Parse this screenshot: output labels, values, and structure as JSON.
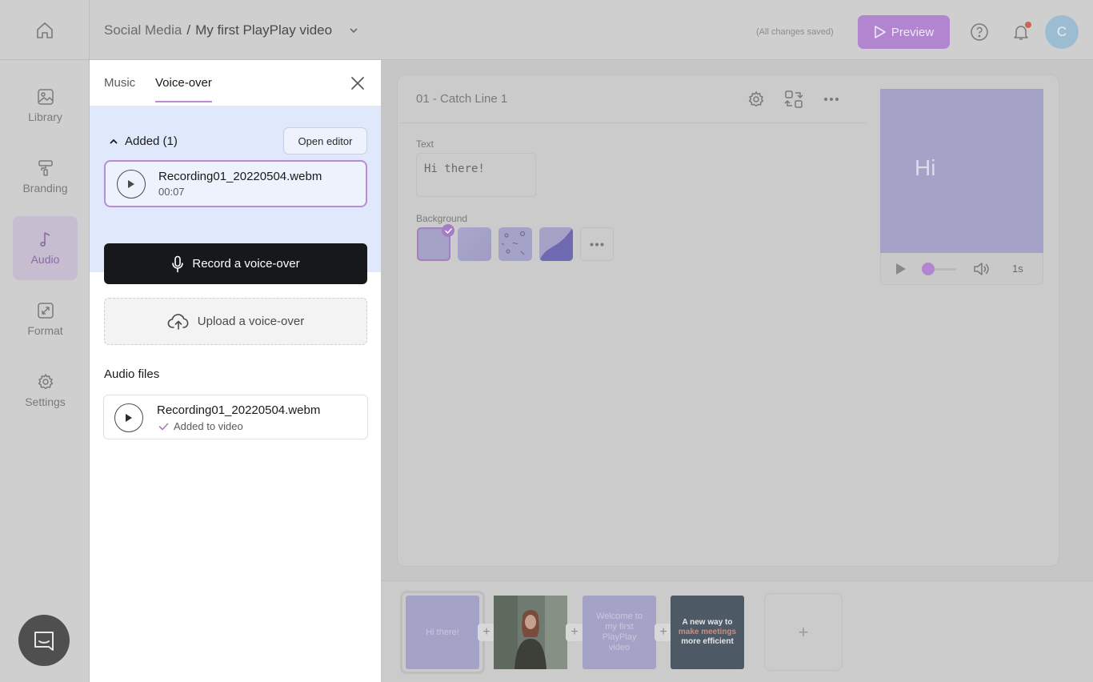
{
  "topbar": {
    "breadcrumb_root": "Social Media",
    "breadcrumb_sep": "/",
    "breadcrumb_current": "My first PlayPlay video",
    "save_status": "(All changes saved)",
    "preview_label": "Preview",
    "avatar_initial": "C"
  },
  "nav": {
    "items": [
      {
        "label": "Library",
        "icon": "image-icon"
      },
      {
        "label": "Branding",
        "icon": "paint-roller-icon"
      },
      {
        "label": "Audio",
        "icon": "music-note-icon",
        "active": true
      },
      {
        "label": "Format",
        "icon": "resize-icon"
      },
      {
        "label": "Settings",
        "icon": "gear-icon"
      }
    ]
  },
  "panel": {
    "tabs": [
      {
        "label": "Music",
        "active": false
      },
      {
        "label": "Voice-over",
        "active": true
      }
    ],
    "added_label": "Added (1)",
    "open_editor_label": "Open editor",
    "added_item": {
      "name": "Recording01_20220504.webm",
      "duration": "00:07"
    },
    "record_label": "Record a voice-over",
    "upload_label": "Upload a voice-over",
    "audio_files_title": "Audio files",
    "files": [
      {
        "name": "Recording01_20220504.webm",
        "status": "Added to video"
      }
    ]
  },
  "scene": {
    "title": "01 - Catch Line 1",
    "text_label": "Text",
    "text_value": "Hi there!",
    "background_label": "Background",
    "preview_text": "Hi",
    "duration": "1s"
  },
  "timeline": {
    "thumb1_text": "Hi there!",
    "thumb3_text": "Welcome to my first PlayPlay video",
    "thumb4_text_a": "A new way to",
    "thumb4_text_b": "make meetings",
    "thumb4_text_c": "more efficient",
    "plus": "+"
  },
  "colors": {
    "accent": "#b98bd8",
    "preview_button": "#b285d0",
    "record_button": "#17181c",
    "added_background": "#e0e8fb",
    "scene_preview": "#a4a2c6"
  }
}
